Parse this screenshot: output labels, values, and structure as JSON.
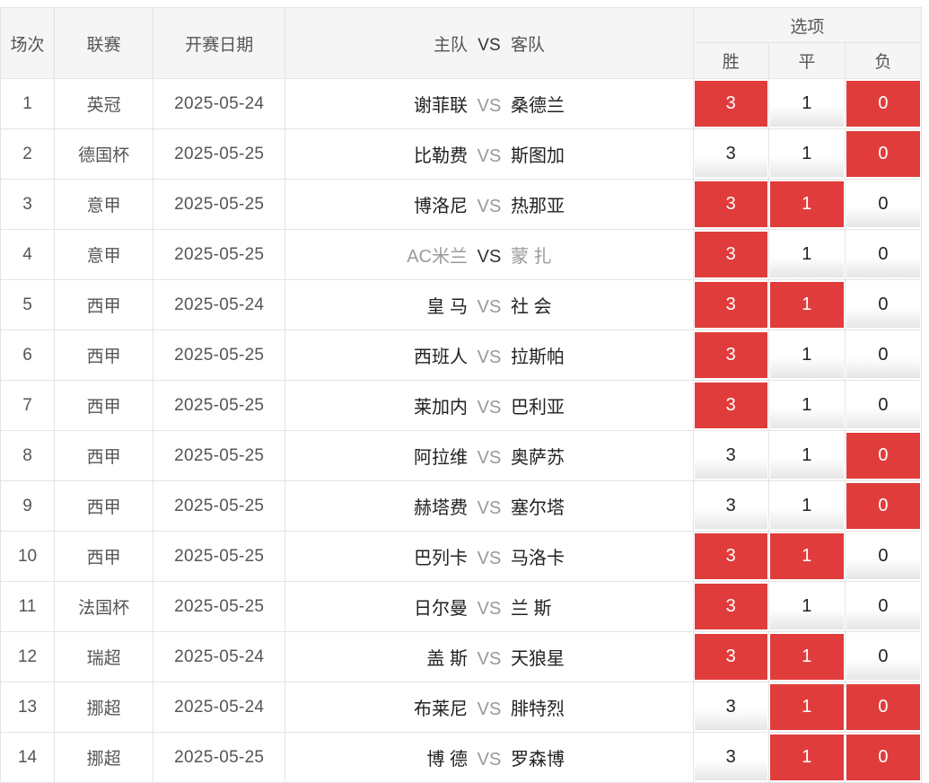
{
  "header": {
    "col_num": "场次",
    "col_league": "联赛",
    "col_date": "开赛日期",
    "col_home": "主队",
    "col_vs": "VS",
    "col_away": "客队",
    "col_options": "选项",
    "opt_win": "胜",
    "opt_draw": "平",
    "opt_lose": "负"
  },
  "rows": [
    {
      "num": "1",
      "league": "英冠",
      "date": "2025-05-24",
      "home": "谢菲联",
      "vs": "VS",
      "away": "桑德兰",
      "win": "3",
      "draw": "1",
      "lose": "0"
    },
    {
      "num": "2",
      "league": "德国杯",
      "date": "2025-05-25",
      "home": "比勒费",
      "vs": "VS",
      "away": "斯图加",
      "win": "3",
      "draw": "1",
      "lose": "0"
    },
    {
      "num": "3",
      "league": "意甲",
      "date": "2025-05-25",
      "home": "博洛尼",
      "vs": "VS",
      "away": "热那亚",
      "win": "3",
      "draw": "1",
      "lose": "0"
    },
    {
      "num": "4",
      "league": "意甲",
      "date": "2025-05-25",
      "home": "AC米兰",
      "vs": "VS",
      "away": "蒙 扎",
      "win": "3",
      "draw": "1",
      "lose": "0"
    },
    {
      "num": "5",
      "league": "西甲",
      "date": "2025-05-24",
      "home": "皇 马",
      "vs": "VS",
      "away": "社 会",
      "win": "3",
      "draw": "1",
      "lose": "0"
    },
    {
      "num": "6",
      "league": "西甲",
      "date": "2025-05-25",
      "home": "西班人",
      "vs": "VS",
      "away": "拉斯帕",
      "win": "3",
      "draw": "1",
      "lose": "0"
    },
    {
      "num": "7",
      "league": "西甲",
      "date": "2025-05-25",
      "home": "莱加内",
      "vs": "VS",
      "away": "巴利亚",
      "win": "3",
      "draw": "1",
      "lose": "0"
    },
    {
      "num": "8",
      "league": "西甲",
      "date": "2025-05-25",
      "home": "阿拉维",
      "vs": "VS",
      "away": "奥萨苏",
      "win": "3",
      "draw": "1",
      "lose": "0"
    },
    {
      "num": "9",
      "league": "西甲",
      "date": "2025-05-25",
      "home": "赫塔费",
      "vs": "VS",
      "away": "塞尔塔",
      "win": "3",
      "draw": "1",
      "lose": "0"
    },
    {
      "num": "10",
      "league": "西甲",
      "date": "2025-05-25",
      "home": "巴列卡",
      "vs": "VS",
      "away": "马洛卡",
      "win": "3",
      "draw": "1",
      "lose": "0"
    },
    {
      "num": "11",
      "league": "法国杯",
      "date": "2025-05-25",
      "home": "日尔曼",
      "vs": "VS",
      "away": "兰 斯",
      "win": "3",
      "draw": "1",
      "lose": "0"
    },
    {
      "num": "12",
      "league": "瑞超",
      "date": "2025-05-24",
      "home": "盖 斯",
      "vs": "VS",
      "away": "天狼星",
      "win": "3",
      "draw": "1",
      "lose": "0"
    },
    {
      "num": "13",
      "league": "挪超",
      "date": "2025-05-24",
      "home": "布莱尼",
      "vs": "VS",
      "away": "腓特烈",
      "win": "3",
      "draw": "1",
      "lose": "0"
    },
    {
      "num": "14",
      "league": "挪超",
      "date": "2025-05-25",
      "home": "博 德",
      "vs": "VS",
      "away": "罗森博",
      "win": "3",
      "draw": "1",
      "lose": "0"
    }
  ],
  "selected": [
    {
      "win": true,
      "draw": false,
      "lose": true
    },
    {
      "win": false,
      "draw": false,
      "lose": true
    },
    {
      "win": true,
      "draw": true,
      "lose": false
    },
    {
      "win": true,
      "draw": false,
      "lose": false
    },
    {
      "win": true,
      "draw": true,
      "lose": false
    },
    {
      "win": true,
      "draw": false,
      "lose": false
    },
    {
      "win": true,
      "draw": false,
      "lose": false
    },
    {
      "win": false,
      "draw": false,
      "lose": true
    },
    {
      "win": false,
      "draw": false,
      "lose": true
    },
    {
      "win": true,
      "draw": true,
      "lose": false
    },
    {
      "win": true,
      "draw": false,
      "lose": false
    },
    {
      "win": true,
      "draw": true,
      "lose": false
    },
    {
      "win": false,
      "draw": true,
      "lose": true
    },
    {
      "win": false,
      "draw": true,
      "lose": true
    }
  ],
  "dimmed_rows": [
    3
  ],
  "colors": {
    "selected_bg": "#e03c3c",
    "header_bg": "#f5f5f5",
    "border": "#e4e4e4",
    "vs_text": "#999999",
    "dim_text": "#9a9a9a"
  }
}
